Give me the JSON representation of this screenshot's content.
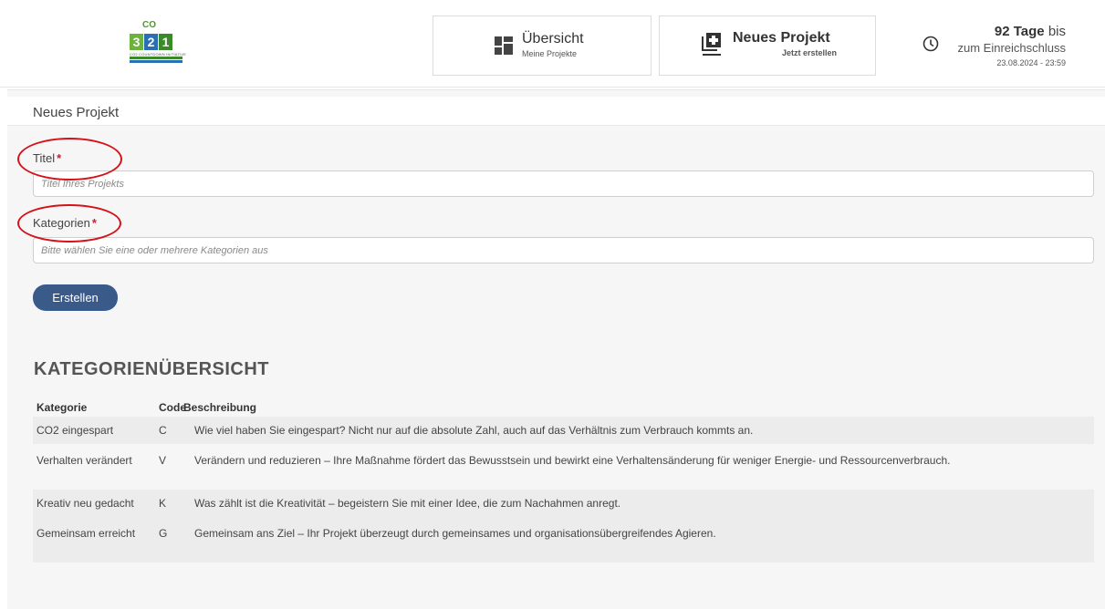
{
  "logo": {
    "numbers": [
      "3",
      "2",
      "1"
    ],
    "co": "CO",
    "subtitle": "CO2 COUNTDOWN INITIATIVE"
  },
  "nav": {
    "overview": {
      "title": "Übersicht",
      "subtitle": "Meine Projekte",
      "icon": "dashboard-grid-icon"
    },
    "new_project": {
      "title": "Neues Projekt",
      "subtitle": "Jetzt erstellen",
      "icon": "add-project-icon"
    }
  },
  "deadline": {
    "days_number": "92 Tage",
    "days_suffix": "bis",
    "label": "zum Einreichschluss",
    "date": "23.08.2024 - 23:59",
    "icon": "clock-icon"
  },
  "form": {
    "panel_title": "Neues Projekt",
    "title_label": "Titel",
    "title_placeholder": "Titel Ihres Projekts",
    "categories_label": "Kategorien",
    "categories_placeholder": "Bitte wählen Sie eine oder mehrere Kategorien aus",
    "required_marker": "*",
    "submit_label": "Erstellen"
  },
  "overview": {
    "title": "KATEGORIENÜBERSICHT",
    "headers": [
      "Kategorie",
      "Code",
      "Beschreibung"
    ],
    "rows": [
      {
        "kategorie": "CO2 eingespart",
        "code": "C",
        "beschreibung": "Wie viel haben Sie eingespart? Nicht nur auf die absolute Zahl, auch auf das Verhältnis zum Verbrauch kommts an."
      },
      {
        "kategorie": "Verhalten verändert",
        "code": "V",
        "beschreibung": "Verändern und reduzieren – Ihre Maßnahme fördert das Bewusstsein und bewirkt eine Verhaltensänderung für weniger Energie- und Ressourcenverbrauch."
      },
      {
        "kategorie": "Kreativ neu gedacht",
        "code": "K",
        "beschreibung": "Was zählt ist die Kreativität – begeistern Sie mit einer Idee, die zum Nachahmen anregt."
      },
      {
        "kategorie": "Gemeinsam erreicht",
        "code": "G",
        "beschreibung": "Gemeinsam ans Ziel – Ihr Projekt überzeugt durch gemeinsames und organisationsübergreifendes Agieren."
      }
    ]
  },
  "colors": {
    "accent_button": "#3a5a8a",
    "annotation_circle": "#d4121a",
    "required": "#c9232a",
    "logo_green": "#6cb33e",
    "logo_blue": "#2a6fb5"
  }
}
